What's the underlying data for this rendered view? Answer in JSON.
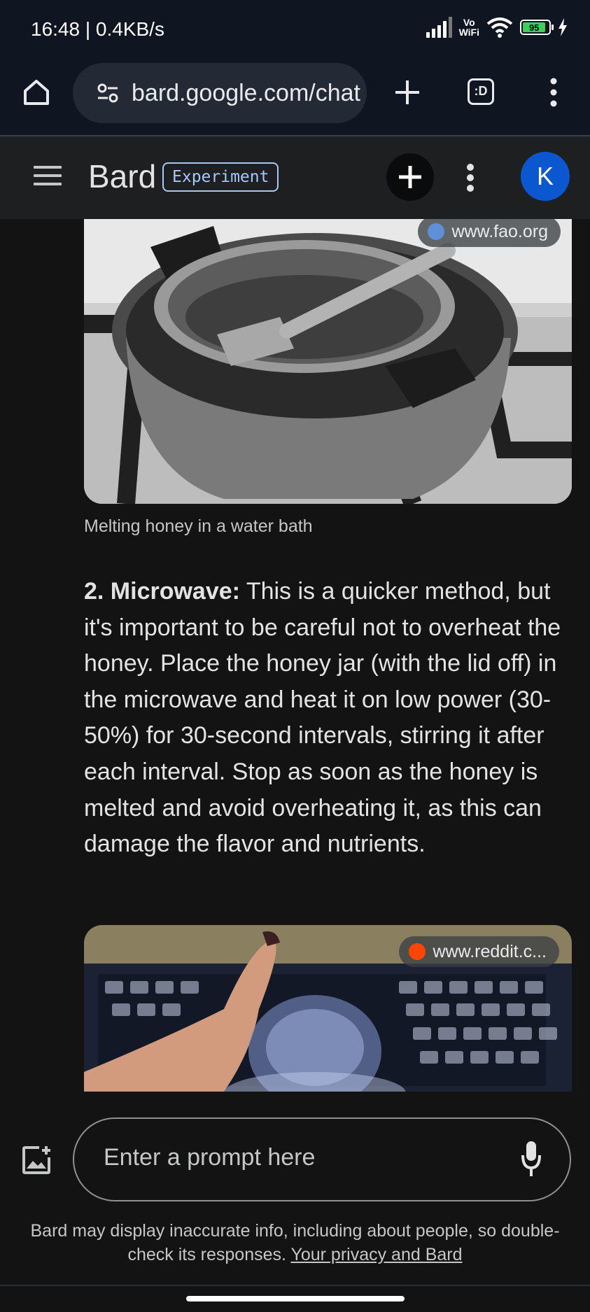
{
  "status_bar": {
    "time": "16:48 | 0.4KB/s",
    "vowifi_top": "Vo",
    "vowifi_bottom": "WiFi",
    "battery": "95"
  },
  "browser": {
    "url": "bard.google.com/chat",
    "tab_count": ":D",
    "icons": [
      "home-icon",
      "site-settings-icon",
      "new-tab-icon",
      "tab-switcher-icon",
      "more-vert-icon"
    ]
  },
  "bard": {
    "title": "Bard",
    "badge": "Experiment",
    "avatar_initial": "K",
    "icons": [
      "menu-icon",
      "new-chat-icon",
      "more-vert-icon"
    ]
  },
  "response": {
    "image1": {
      "source": "www.fao.org",
      "caption": "Melting honey in a water bath"
    },
    "step_title": "2. Microwave:",
    "step_body": " This is a quicker method, but it's important to be careful not to overheat the honey. Place the honey jar (with the lid off) in the microwave and heat it on low power (30-50%) for 30-second intervals, stirring it after each interval. Stop as soon as the honey is melted and avoid overheating it, as this can damage the flavor and nutrients.",
    "image2": {
      "source": "www.reddit.c..."
    }
  },
  "input": {
    "placeholder": "Enter a prompt here"
  },
  "footer": {
    "disclaimer": "Bard may display inaccurate info, including about people, so double-check its responses. ",
    "privacy_link": "Your privacy and Bard"
  },
  "colors": {
    "background": "#131314",
    "header": "#1e1f20",
    "badge": "#a8c7fa",
    "avatar": "#0b57d0",
    "battery": "#3ecf5a"
  }
}
